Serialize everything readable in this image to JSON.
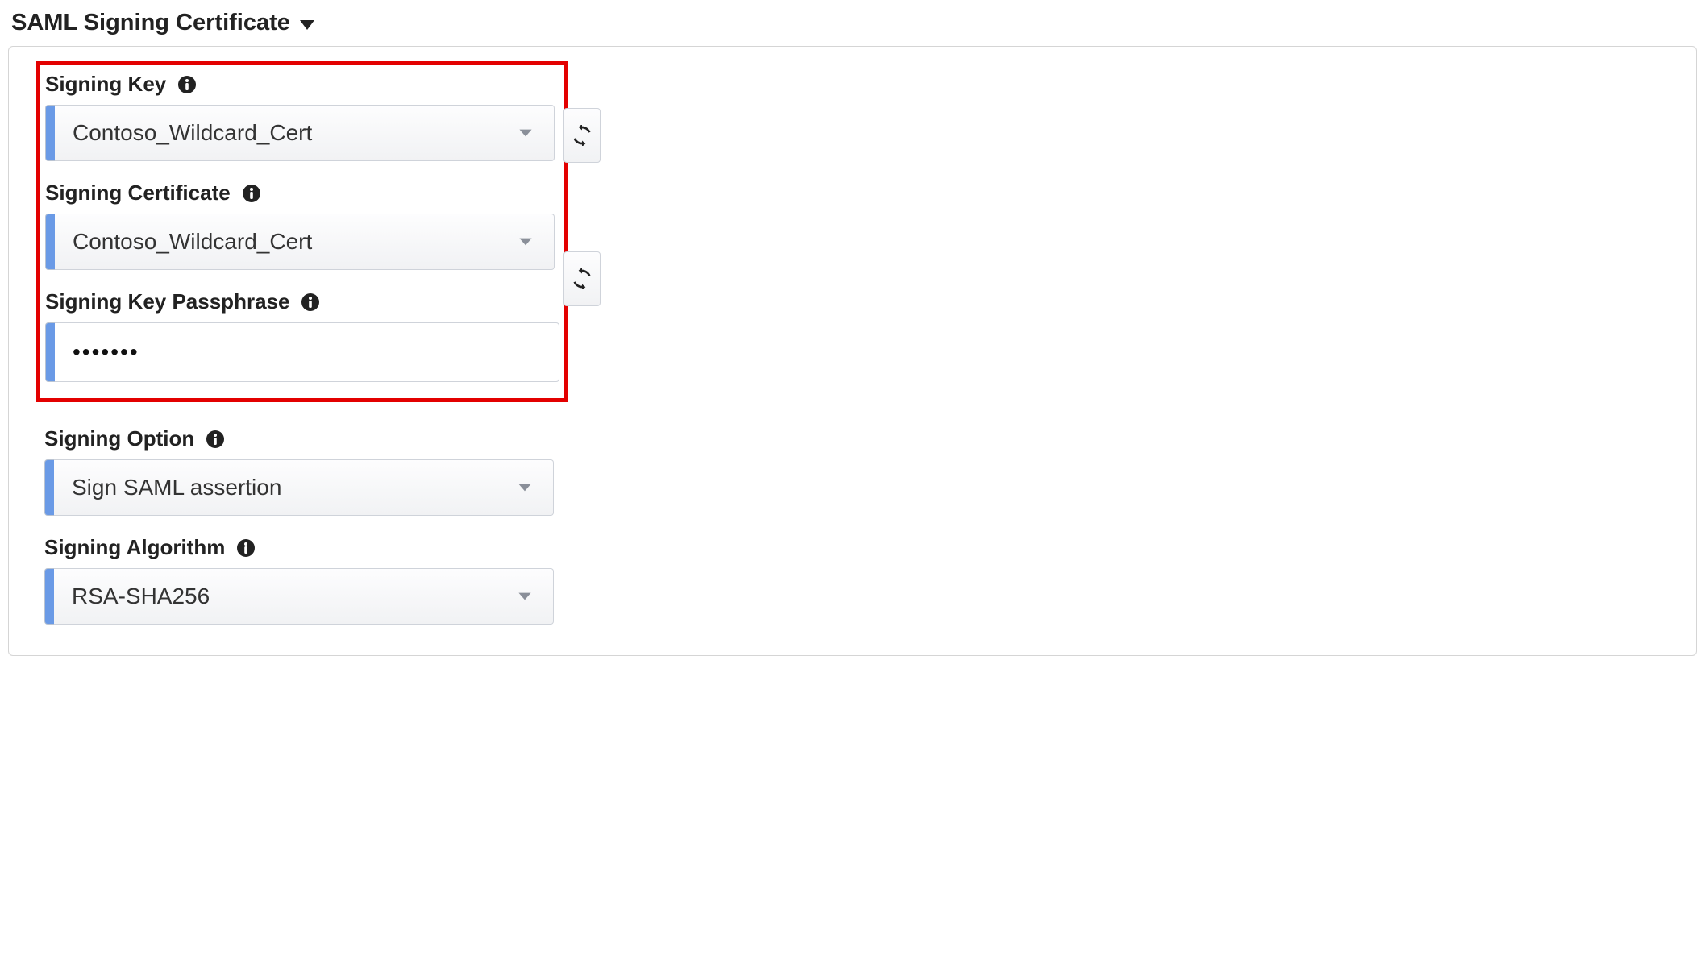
{
  "section": {
    "title": "SAML Signing Certificate"
  },
  "signing_key": {
    "label": "Signing Key",
    "value": "Contoso_Wildcard_Cert"
  },
  "signing_cert": {
    "label": "Signing Certificate",
    "value": "Contoso_Wildcard_Cert"
  },
  "passphrase": {
    "label": "Signing Key Passphrase",
    "value": "•••••••"
  },
  "signing_option": {
    "label": "Signing Option",
    "value": "Sign SAML assertion"
  },
  "signing_algo": {
    "label": "Signing Algorithm",
    "value": "RSA-SHA256"
  }
}
